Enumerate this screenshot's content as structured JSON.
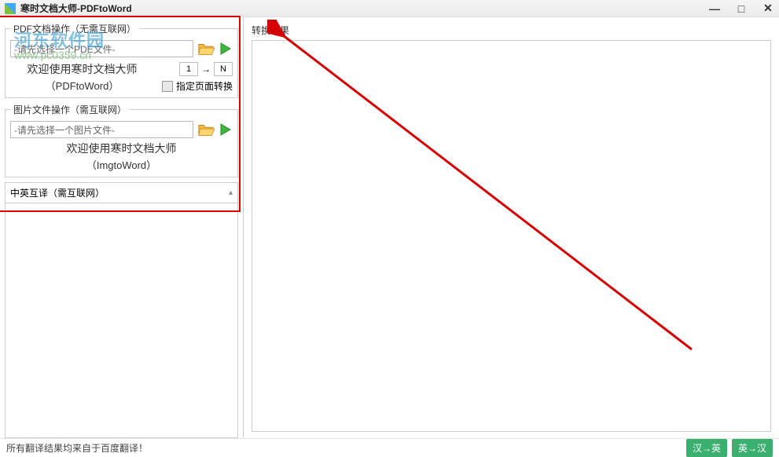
{
  "titlebar": {
    "title": "寒时文档大师-PDFtoWord"
  },
  "watermark": {
    "text": "河东软件园",
    "url": "www.pc0359.cn"
  },
  "pdf_section": {
    "legend": "PDF文档操作（无需互联网）",
    "placeholder": "-请先选择一个PDE文件-",
    "welcome_line1": "欢迎使用寒时文档大师",
    "welcome_line2": "（PDFtoWord）",
    "page_from": "1",
    "page_to": "N",
    "specify_label": "指定页面转换"
  },
  "img_section": {
    "legend": "图片文件操作（需互联网）",
    "placeholder": "-请先选择一个图片文件-",
    "welcome_line1": "欢迎使用寒时文档大师",
    "welcome_line2": "（ImgtoWord）"
  },
  "translate_section": {
    "legend": "中英互译（需互联网）"
  },
  "bottom": {
    "credit": "所有翻译结果均来自于百度翻译！",
    "btn_cn_en": "汉→英",
    "btn_en_cn": "英→汉"
  },
  "right": {
    "label": "转换结果"
  }
}
